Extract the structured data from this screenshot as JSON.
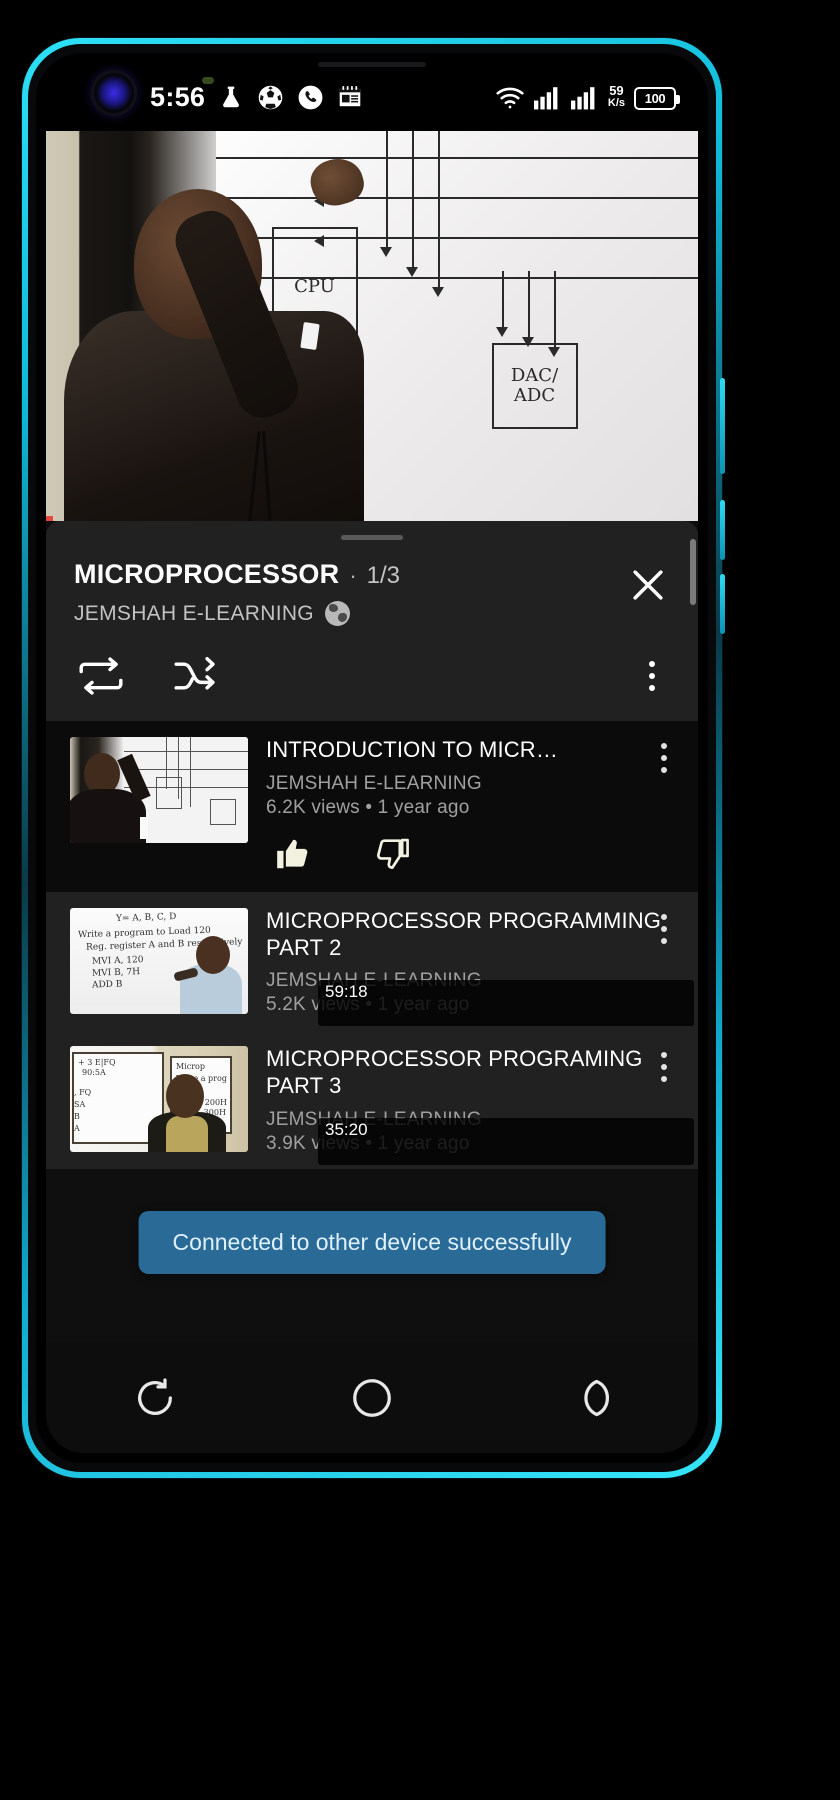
{
  "status_bar": {
    "time": "5:56",
    "left_icons": [
      "camera-punch-hole",
      "flask-icon",
      "soccer-ball-icon",
      "phone-call-icon",
      "calendar-icon"
    ],
    "right_icons": [
      "wifi-icon",
      "signal-sim1-icon",
      "signal-sim2-icon"
    ],
    "net_speed_value": "59",
    "net_speed_unit": "K/s",
    "battery_level": "100"
  },
  "player": {
    "name": "video-player",
    "board_labels": [
      "CPU",
      "DAC/ ADC"
    ]
  },
  "now_playing": {
    "title": "MICROPROCESSOR",
    "separator": "·",
    "position": "1/3",
    "channel": "JEMSHAH E-LEARNING",
    "verified_icon": "globe-icon",
    "close_icon": "close-icon",
    "loop_icon": "loop-icon",
    "shuffle_icon": "shuffle-icon",
    "more_icon": "more-vertical-icon"
  },
  "queue": [
    {
      "title": "INTRODUCTION TO MICR…",
      "channel": "JEMSHAH E-LEARNING",
      "stats": "6.2K views • 1 year ago",
      "duration": "",
      "like_icon": "thumbs-up-icon",
      "dislike_icon": "thumbs-down-icon",
      "more_icon": "more-vertical-icon",
      "active": true
    },
    {
      "title": "MICROPROCESSOR PROGRAMMING PART 2",
      "channel": "JEMSHAH E-LEARNING",
      "stats": "5.2K views • 1 year ago",
      "duration": "59:18",
      "more_icon": "more-vertical-icon",
      "active": false
    },
    {
      "title": "MICROPROCESSOR PROGRAMING PART 3",
      "channel": "JEMSHAH E-LEARNING",
      "stats": "3.9K views • 1 year ago",
      "duration": "35:20",
      "more_icon": "more-vertical-icon",
      "active": false
    }
  ],
  "toast": {
    "message": "Connected to other device successfully",
    "background": "#2a6a96",
    "text_color": "#dff1ff"
  },
  "nav_bar": {
    "recents_icon": "recents-icon",
    "home_icon": "home-icon",
    "back_icon": "back-icon"
  },
  "colors": {
    "phone_frame": "#2de0f7",
    "panel_bg": "#212121",
    "list_bg": "#0f0f0f",
    "text_primary": "#ffffff",
    "text_secondary": "#a0a0a0"
  }
}
